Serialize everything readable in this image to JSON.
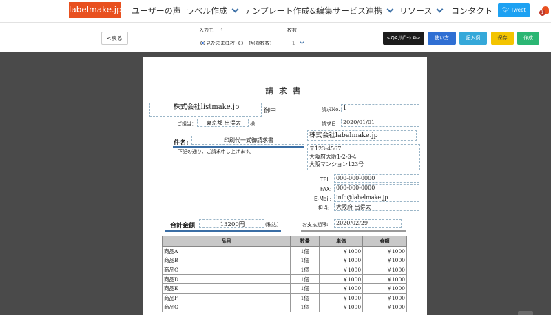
{
  "nav": {
    "logo": "labelmake.jp",
    "items": [
      {
        "label": "ユーザーの声",
        "dropdown": false
      },
      {
        "label": "ラベル作成",
        "dropdown": true
      },
      {
        "label": "テンプレート作成&編集",
        "dropdown": false
      },
      {
        "label": "サービス連携",
        "dropdown": true
      },
      {
        "label": "リソース",
        "dropdown": true
      },
      {
        "label": "コンタクト",
        "dropdown": false
      }
    ],
    "tweet": "Tweet",
    "notification_count": "1"
  },
  "toolbar": {
    "back": "<戻る",
    "input_mode_label": "入力モード",
    "mode_options": [
      {
        "label": "見たまま(1枚)",
        "selected": true
      },
      {
        "label": "一括(複数枚)",
        "selected": false
      }
    ],
    "count_label": "枚数",
    "count_value": "1",
    "qa_support": "<QA,ｻﾎﾟｰﾄ",
    "howto": "使い方",
    "example": "記入例",
    "save": "保存",
    "create": "作成"
  },
  "invoice": {
    "title": "請 求 書",
    "customer": "株式会社listmake.jp",
    "honorific": "御中",
    "contact_label": "ご担当：",
    "contact_name": "東京都 出得太",
    "contact_suffix": "様",
    "subject_label": "件名:",
    "subject": "印刷代一式御請求書",
    "intro": "下記の通り、ご請求申し上げます。",
    "invoice_no_label": "請求No.",
    "invoice_no": "1",
    "date_label": "請求日",
    "date": "2020/01/01",
    "issuer_company": "株式会社labelmake.jp",
    "issuer_zip": "〒123-4567",
    "issuer_addr1": "大阪府大阪1-2-3-4",
    "issuer_addr2": "大阪マンション123号",
    "tel_label": "TEL:",
    "tel": "000-000-0000",
    "fax_label": "FAX:",
    "fax": "000-000-0000",
    "email_label": "E-Mail:",
    "email": "info@labelmake.jp",
    "rep_label": "担当:",
    "rep": "大阪府 出得太",
    "total_label": "合計金額",
    "total": "13200円",
    "tax_note": "(税込)",
    "due_label": "お支払期限:",
    "due": "2020/02/29",
    "table": {
      "headers": [
        "品目",
        "数量",
        "単価",
        "金額"
      ],
      "rows": [
        [
          "商品A",
          "1個",
          "￥1000",
          "￥1000"
        ],
        [
          "商品B",
          "1個",
          "￥1000",
          "￥1000"
        ],
        [
          "商品C",
          "1個",
          "￥1000",
          "￥1000"
        ],
        [
          "商品D",
          "1個",
          "￥1000",
          "￥1000"
        ],
        [
          "商品E",
          "1個",
          "￥1000",
          "￥1000"
        ],
        [
          "商品F",
          "1個",
          "￥1000",
          "￥1000"
        ],
        [
          "商品G",
          "1個",
          "￥1000",
          "￥1000"
        ]
      ]
    }
  }
}
